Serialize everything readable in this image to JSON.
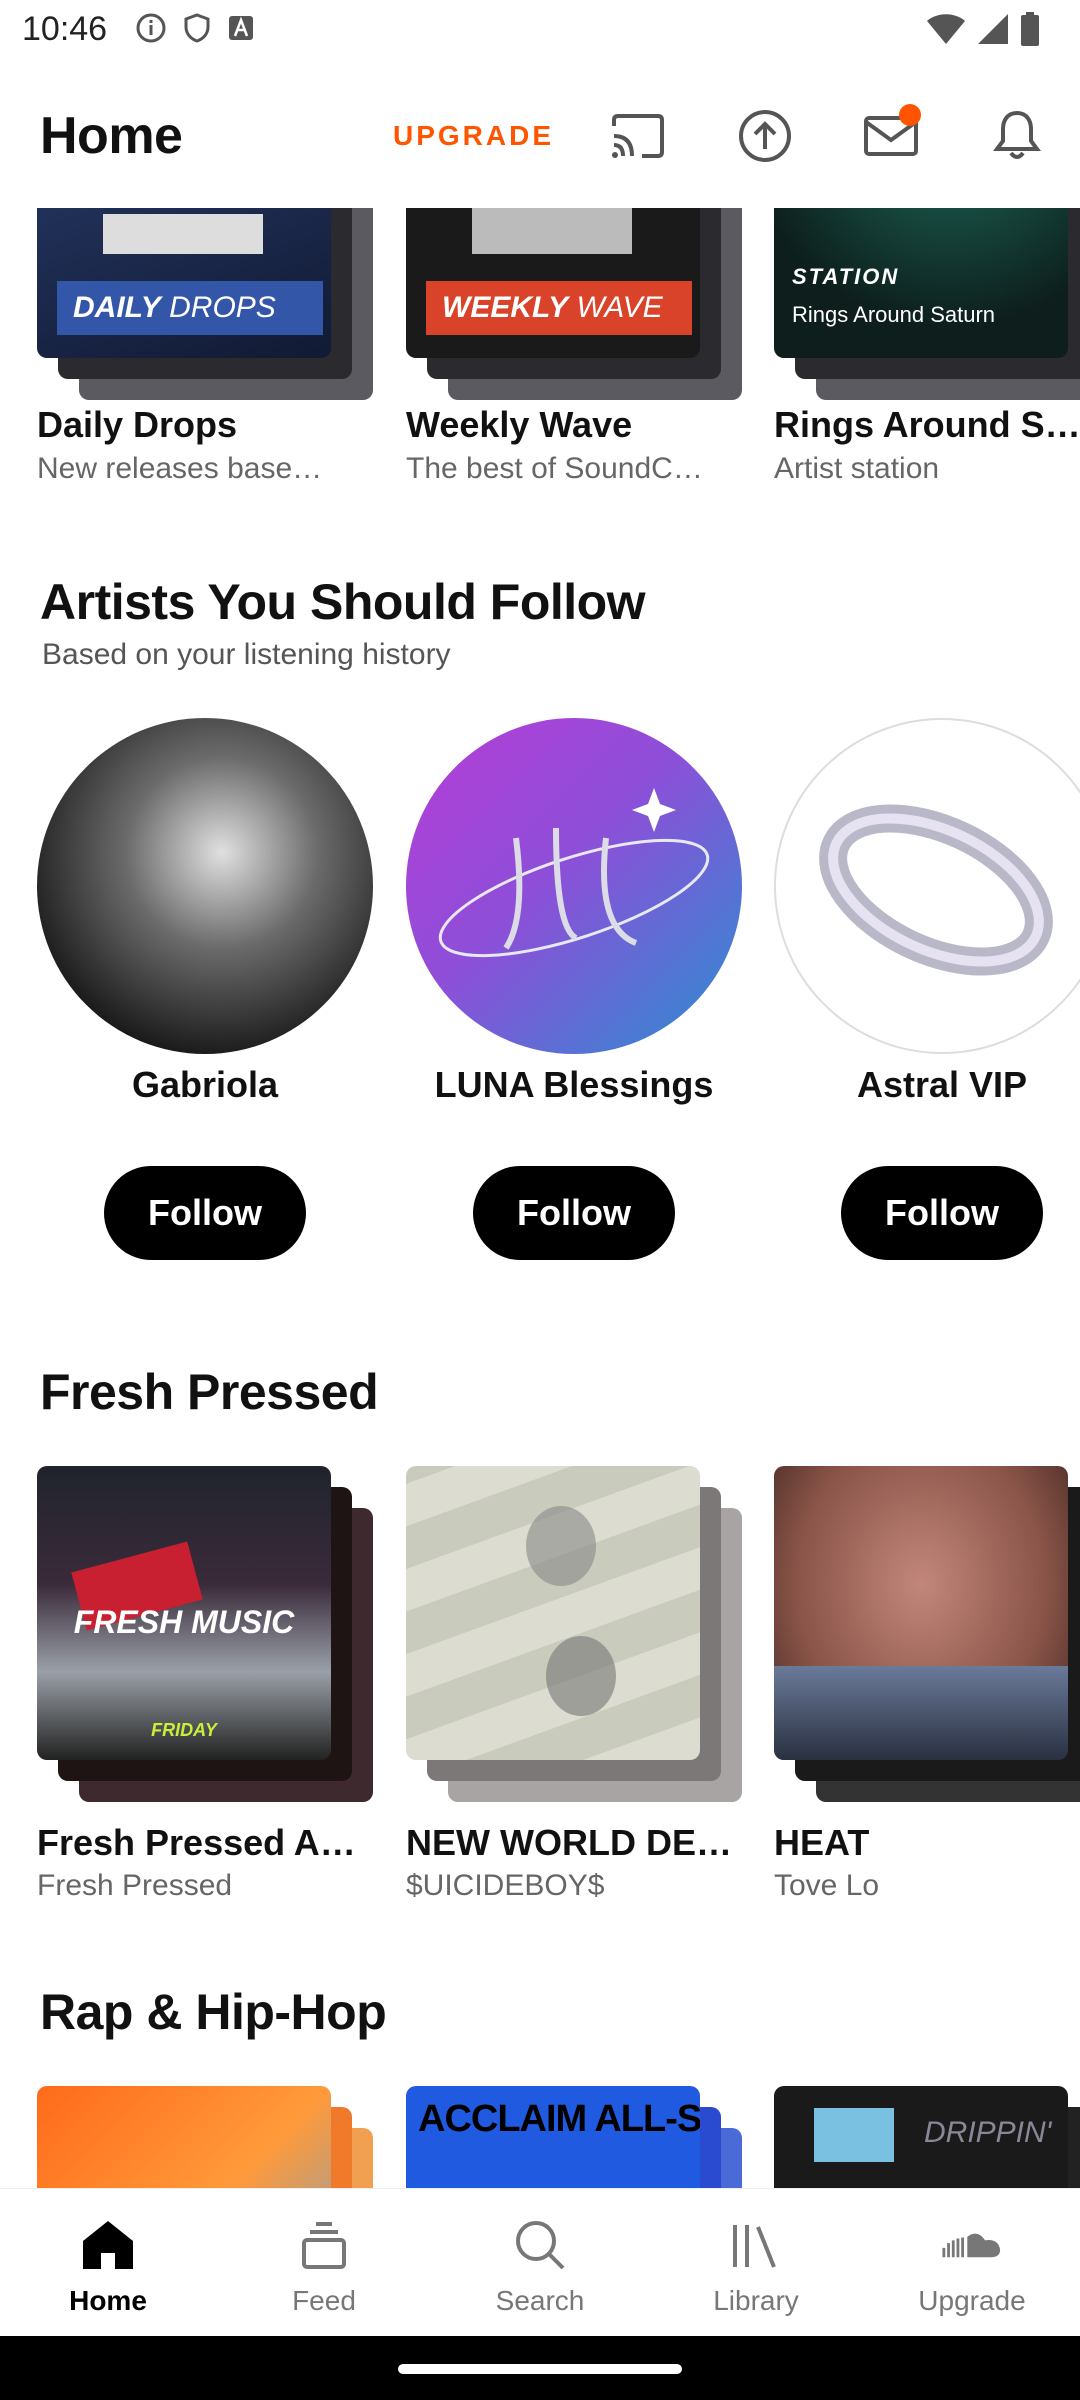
{
  "status_bar": {
    "time": "10:46"
  },
  "header": {
    "title": "Home",
    "upgrade_label": "UPGRADE"
  },
  "top_row": [
    {
      "title": "Daily Drops",
      "subtitle": "New releases base…",
      "art_text_bold": "DAILY",
      "art_text_light": "DROPS"
    },
    {
      "title": "Weekly Wave",
      "subtitle": "The best of SoundC…",
      "art_text_bold": "WEEKLY",
      "art_text_light": "WAVE"
    },
    {
      "title": "Rings Around S…",
      "subtitle": "Artist station",
      "art_text_bold": "STATION",
      "art_text_light": "Rings Around Saturn"
    }
  ],
  "artists_section": {
    "title": "Artists You Should Follow",
    "subtitle": "Based on your listening history",
    "artists": [
      {
        "name": "Gabriola",
        "follow_label": "Follow"
      },
      {
        "name": "LUNA Blessings",
        "follow_label": "Follow"
      },
      {
        "name": "Astral VIP",
        "follow_label": "Follow"
      }
    ]
  },
  "fresh_section": {
    "title": "Fresh Pressed",
    "items": [
      {
        "title": "Fresh Pressed A…",
        "subtitle": "Fresh Pressed",
        "art_text": "FRESH MUSIC",
        "art_text2": "FRIDAY"
      },
      {
        "title": "NEW WORLD DE…",
        "subtitle": "$UICIDEBOY$"
      },
      {
        "title": "HEAT",
        "subtitle": "Tove Lo"
      }
    ]
  },
  "rap_section": {
    "title": "Rap & Hip-Hop",
    "items": [
      {
        "art_text": ""
      },
      {
        "art_text": "ACCLAIM ALL-STARS"
      },
      {
        "art_text": "DRIPPIN'"
      }
    ]
  },
  "bottom_nav": [
    {
      "label": "Home",
      "icon": "home-icon",
      "active": true
    },
    {
      "label": "Feed",
      "icon": "feed-icon",
      "active": false
    },
    {
      "label": "Search",
      "icon": "search-icon",
      "active": false
    },
    {
      "label": "Library",
      "icon": "library-icon",
      "active": false
    },
    {
      "label": "Upgrade",
      "icon": "soundcloud-icon",
      "active": false
    }
  ],
  "colors": {
    "accent": "#ff5500",
    "text": "#111111",
    "muted": "#666666"
  }
}
